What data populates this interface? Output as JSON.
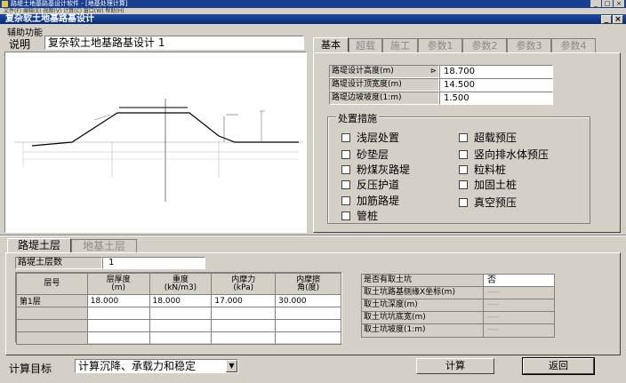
{
  "app": {
    "taskbar_title": "路堤土地基路基设计软件 - [地基处理计算]",
    "window_title": "复杂软土地基路基设计",
    "menu": "辅助功能",
    "topbar_menu": "文件(F)  编辑(E)  视图(V)  计算(C)  窗口(W)  帮助(H)"
  },
  "description": {
    "label": "说明",
    "value": "复杂软土地基路基设计 1"
  },
  "tabs": [
    "基本",
    "超载",
    "施工",
    "参数1",
    "参数2",
    "参数3",
    "参数4"
  ],
  "basic_params": [
    {
      "label": "路堤设计高度(m)",
      "value": "18.700"
    },
    {
      "label": "路堤设计顶宽度(m)",
      "value": "14.500"
    },
    {
      "label": "路堤边坡坡度(1:m)",
      "value": "1.500"
    }
  ],
  "measures": {
    "title": "处置措施",
    "left": [
      "浅层处置",
      "砂垫层",
      "粉煤灰路堤",
      "反压护道",
      "加筋路堤",
      "管桩"
    ],
    "right": [
      "超载预压",
      "竖向排水体预压",
      "粒料桩",
      "加固土桩",
      "真空预压"
    ]
  },
  "soil_tabs": [
    "路堤土层",
    "地基土层"
  ],
  "layer_count": {
    "label": "路堤土层数",
    "value": "1"
  },
  "layer_table": {
    "headers": [
      "层号",
      "层厚度\n(m)",
      "重度\n(kN/m3)",
      "内摩力\n(kPa)",
      "内摩擦\n角(度)"
    ],
    "rows": [
      [
        "第1层",
        "18.000",
        "18.000",
        "17.000",
        "30.000"
      ]
    ]
  },
  "borrow_pit": [
    {
      "label": "是否有取土坑",
      "value": "否"
    },
    {
      "label": "取土坑路基侧缘X坐标(m)",
      "value": "----"
    },
    {
      "label": "取土坑深度(m)",
      "value": "----"
    },
    {
      "label": "取土坑坑底宽(m)",
      "value": "----"
    },
    {
      "label": "取土坑坡度(1:m)",
      "value": "----"
    }
  ],
  "calc_target": {
    "label": "计算目标",
    "value": "计算沉降、承载力和稳定"
  },
  "buttons": {
    "calc": "计算",
    "back": "返回"
  }
}
